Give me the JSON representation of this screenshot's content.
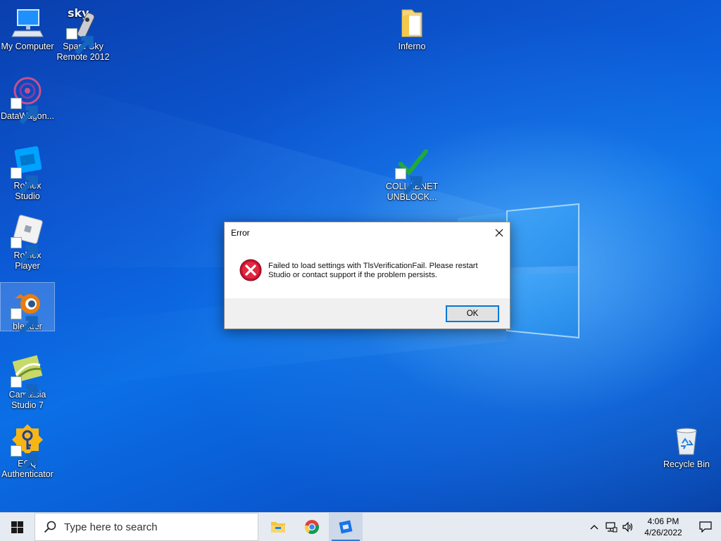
{
  "desktop": {
    "icons": [
      {
        "label": "My Computer"
      },
      {
        "label": "Spare Sky\nRemote 2012",
        "badge": "sky"
      },
      {
        "label": "DataWagon..."
      },
      {
        "label": "Roblox Studio"
      },
      {
        "label": "Roblox Player"
      },
      {
        "label": "blender"
      },
      {
        "label": "Camtasia\nStudio 7"
      },
      {
        "label": "EOQ\nAuthenticator"
      },
      {
        "label": "Inferno"
      },
      {
        "label": "COLLABNET\nUNBLOCK..."
      },
      {
        "label": "Recycle Bin"
      }
    ]
  },
  "dialog": {
    "title": "Error",
    "message": "Failed to load settings with TlsVerificationFail. Please restart Studio or contact support if the problem persists.",
    "ok_label": "OK",
    "icon": "error-icon"
  },
  "taskbar": {
    "search_placeholder": "Type here to search",
    "pinned": [
      "file-explorer-icon",
      "chrome-icon",
      "roblox-studio-icon"
    ],
    "clock_time": "4:06 PM",
    "clock_date": "4/26/2022"
  },
  "colors": {
    "accent": "#0078d7",
    "error_red": "#c8102e",
    "taskbar": "#e6ebf1"
  }
}
